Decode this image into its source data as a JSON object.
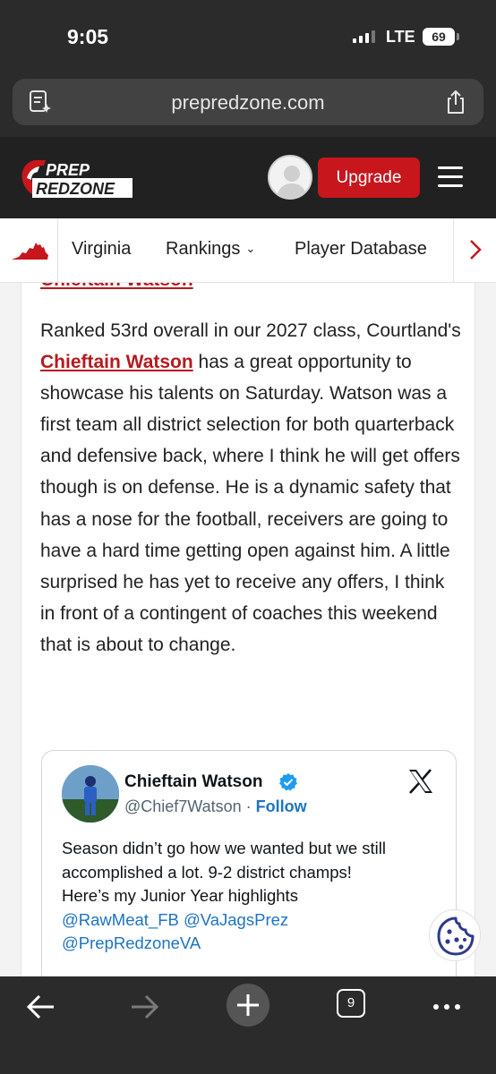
{
  "status_bar": {
    "time": "9:05",
    "network": "LTE",
    "battery": "69"
  },
  "browser": {
    "url": "prepredzone.com"
  },
  "header": {
    "upgrade_label": "Upgrade",
    "logo_line1": "PREP",
    "logo_line2": "REDZONE"
  },
  "nav": {
    "items": [
      {
        "label": "Virginia"
      },
      {
        "label": "Rankings"
      },
      {
        "label": "Player Database"
      }
    ]
  },
  "article": {
    "cut_heading": "Chieftain Watson",
    "paragraph_part1": "Ranked 53rd overall in our 2027 class, Courtland's ",
    "paragraph_link": "Chieftain Watson",
    "paragraph_part2": " has a great opportunity to showcase his talents on Saturday. Watson was a first team all district selection for both quarterback and defensive back, where I think he will get offers though is on defense. He is a dynamic safety that has a nose for the football, receivers are going to have a hard time getting open against him. A little surprised he has yet to receive any offers, I think in front of a contingent of coaches this weekend that is about to change."
  },
  "tweet": {
    "name": "Chieftain Watson",
    "handle": "@Chief7Watson",
    "separator": " · ",
    "follow_label": "Follow",
    "text_lines": [
      "Season didn’t go how we wanted but we still",
      "accomplished a lot. 9-2 district champs!",
      "Here’s my Junior Year highlights"
    ],
    "mentions_line1": "@RawMeat_FB @VaJagsPrez",
    "mentions_line2": "@PrepRedzoneVA"
  },
  "toolbar": {
    "tab_count": "9"
  },
  "colors": {
    "brand_red": "#c8161d",
    "link_red": "#b51a1f",
    "twitter_blue": "#1d74c2",
    "chrome_dark": "#2b2b2b"
  }
}
